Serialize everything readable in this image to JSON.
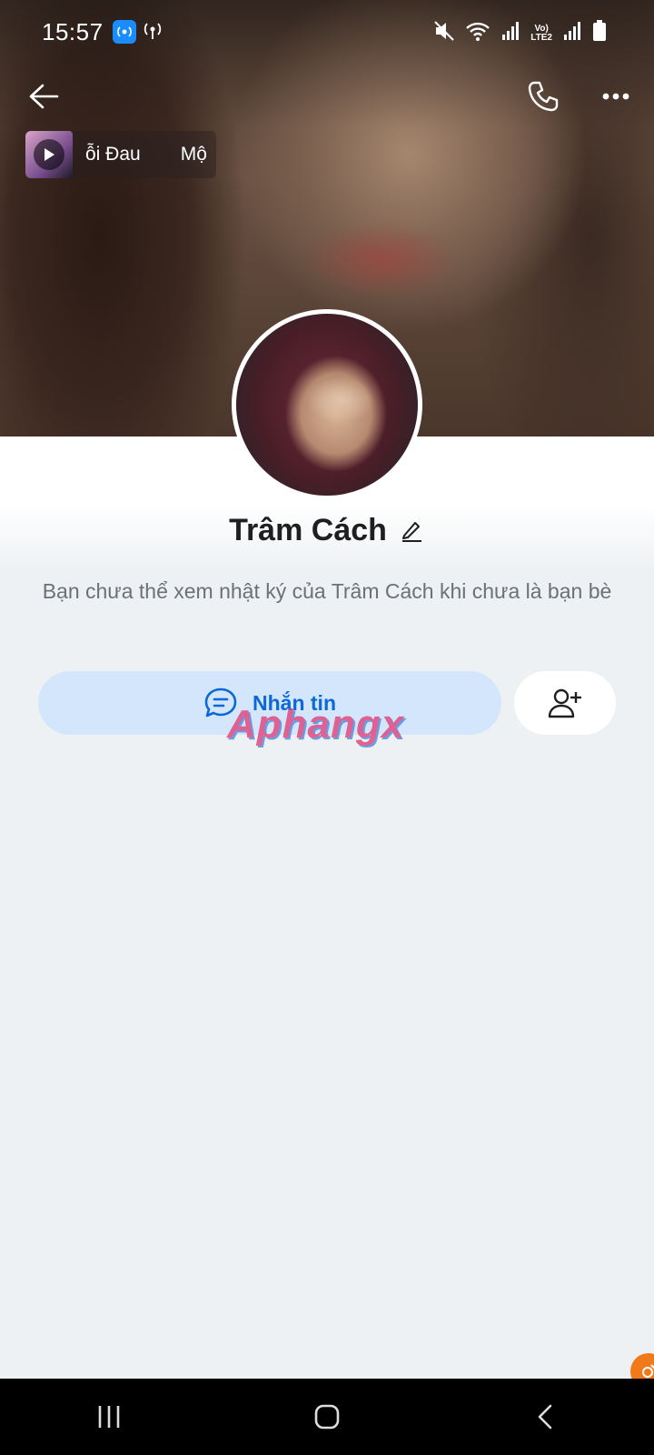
{
  "status_bar": {
    "time": "15:57",
    "network_label_top": "Vo)",
    "network_label_bottom": "LTE2"
  },
  "header": {
    "back_icon": "arrow-left-icon",
    "call_icon": "phone-icon",
    "more_icon": "more-dots-icon"
  },
  "music": {
    "title_visible": "ỗi Đau",
    "next_title_visible": "Mộ"
  },
  "profile": {
    "name": "Trâm Cách",
    "notice": "Bạn chưa thể xem nhật ký của Trâm Cách khi chưa là bạn bè"
  },
  "actions": {
    "message_label": "Nhắn tin",
    "add_friend_icon": "add-user-icon"
  },
  "watermark": "Aphangx",
  "colors": {
    "accent": "#0a68d8",
    "message_bg": "#d4e6fc",
    "page_bg": "#eef1f4"
  }
}
